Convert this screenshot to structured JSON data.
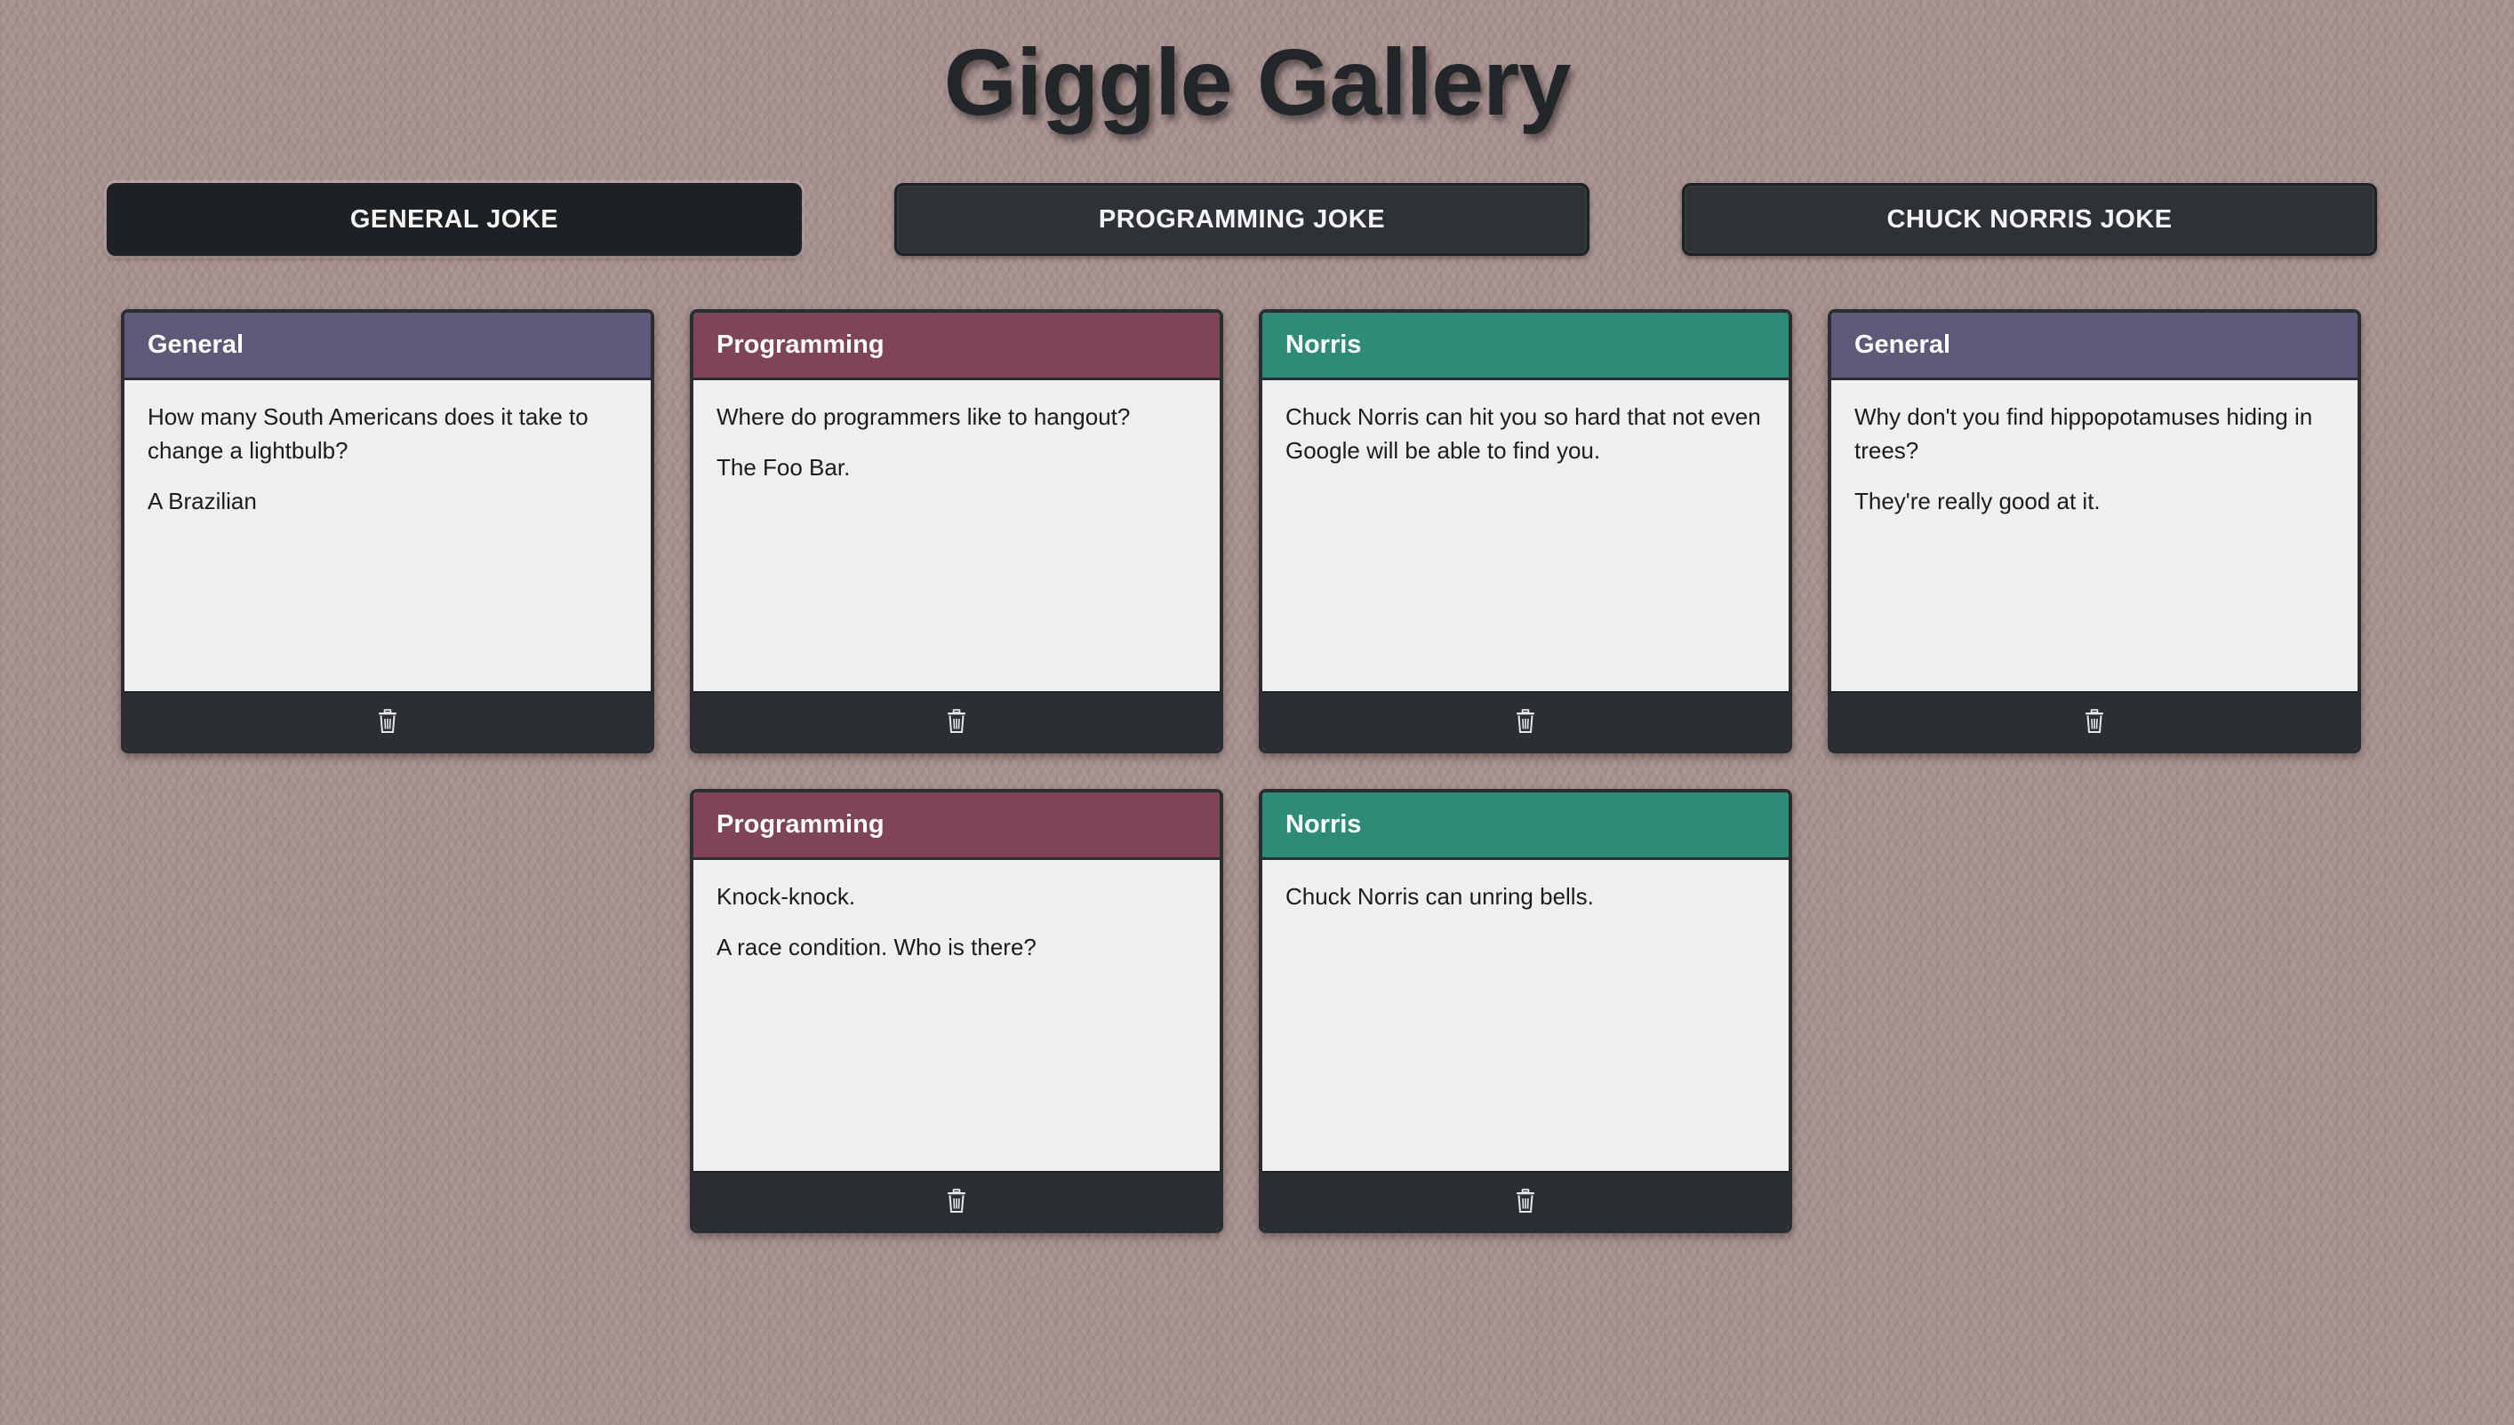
{
  "app": {
    "title": "Giggle Gallery"
  },
  "toolbar": {
    "buttons": [
      {
        "label": "GENERAL JOKE",
        "active": true
      },
      {
        "label": "PROGRAMMING JOKE",
        "active": false
      },
      {
        "label": "CHUCK NORRIS JOKE",
        "active": false
      }
    ]
  },
  "colors": {
    "background": "#a89290",
    "general": "#5f5878",
    "programming": "#804457",
    "norris": "#2e8b77",
    "dark": "#2b2f33",
    "card_body": "#efefef"
  },
  "cards": [
    {
      "category": "General",
      "setup": "How many South Americans does it take to change a lightbulb?",
      "punchline": "A Brazilian",
      "delete_icon": "trash-icon"
    },
    {
      "category": "Programming",
      "setup": "Where do programmers like to hangout?",
      "punchline": "The Foo Bar.",
      "delete_icon": "trash-icon"
    },
    {
      "category": "Norris",
      "setup": "Chuck Norris can hit you so hard that not even Google will be able to find you.",
      "punchline": "",
      "delete_icon": "trash-icon"
    },
    {
      "category": "General",
      "setup": "Why don't you find hippopotamuses hiding in trees?",
      "punchline": "They're really good at it.",
      "delete_icon": "trash-icon"
    },
    {
      "category": "Programming",
      "setup": "Knock-knock.",
      "punchline": "A race condition. Who is there?",
      "delete_icon": "trash-icon"
    },
    {
      "category": "Norris",
      "setup": "Chuck Norris can unring bells.",
      "punchline": "",
      "delete_icon": "trash-icon"
    }
  ]
}
